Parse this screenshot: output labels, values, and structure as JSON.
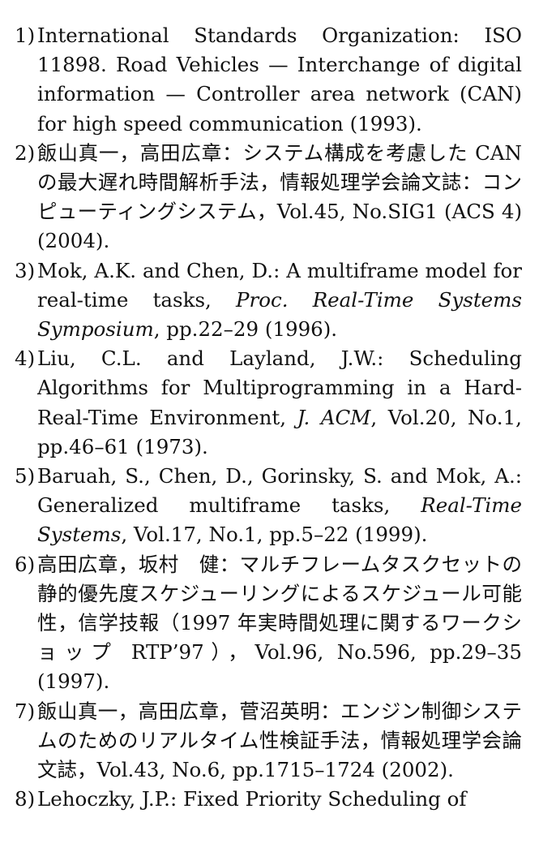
{
  "references": [
    {
      "num": "1)",
      "before": "International Standards Organization: ISO 11898. Road Vehicles — Interchange of digital information — Controller area network (CAN) for high speed communication (1993).",
      "italic": "",
      "after": ""
    },
    {
      "num": "2)",
      "before": "飯山真一，高田広章：システム構成を考慮した CAN の最大遅れ時間解析手法，情報処理学会論文誌：コンピューティングシステム，Vol.45, No.SIG1 (ACS 4) (2004).",
      "italic": "",
      "after": ""
    },
    {
      "num": "3)",
      "before": "Mok, A.K. and Chen, D.: A multiframe model for real-time tasks, ",
      "italic": "Proc. Real-Time Systems Symposium",
      "after": ", pp.22–29 (1996)."
    },
    {
      "num": "4)",
      "before": "Liu, C.L. and Layland, J.W.: Scheduling Algorithms for Multiprogramming in a Hard-Real-Time Environment, ",
      "italic": "J. ACM",
      "after": ", Vol.20, No.1, pp.46–61 (1973)."
    },
    {
      "num": "5)",
      "before": "Baruah, S., Chen, D., Gorinsky, S. and Mok, A.: Generalized multiframe tasks, ",
      "italic": "Real-Time Systems",
      "after": ", Vol.17, No.1, pp.5–22 (1999)."
    },
    {
      "num": "6)",
      "before": "高田広章，坂村　健：マルチフレームタスクセットの静的優先度スケジューリングによるスケジュール可能性，信学技報（1997 年実時間処理に関するワークショップ RTP’97），Vol.96, No.596, pp.29–35 (1997).",
      "italic": "",
      "after": ""
    },
    {
      "num": "7)",
      "before": "飯山真一，高田広章，菅沼英明：エンジン制御システムのためのリアルタイム性検証手法，情報処理学会論文誌，Vol.43, No.6, pp.1715–1724 (2002).",
      "italic": "",
      "after": ""
    },
    {
      "num": "8)",
      "before": "Lehoczky, J.P.: Fixed Priority Scheduling of",
      "italic": "",
      "after": ""
    }
  ]
}
